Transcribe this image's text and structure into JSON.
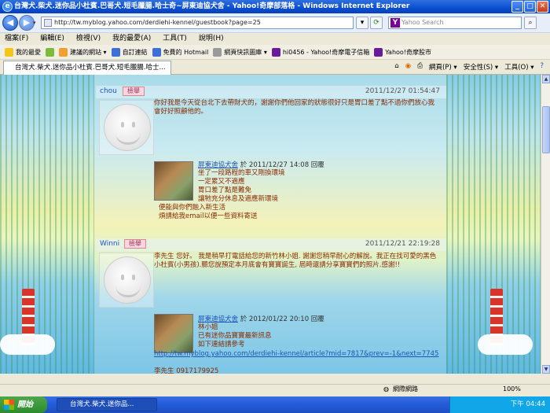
{
  "window": {
    "title": "台灣犬.柴犬.迷你品小杜賓.巴哥犬.短毛臘腸.哈士奇~屏東迪協犬舍 - Yahoo!奇摩部落格 - Windows Internet Explorer"
  },
  "address": {
    "url": "http://tw.myblog.yahoo.com/derdiehi-kennel/guestbook?page=25",
    "search_placeholder": "Yahoo Search"
  },
  "menu": [
    "檔案(F)",
    "編輯(E)",
    "檢視(V)",
    "我的最愛(A)",
    "工具(T)",
    "說明(H)"
  ],
  "favorites": {
    "label": "我的最愛",
    "items": [
      "建議的網站 ▾",
      "自訂連結",
      "免費的 Hotmail",
      "網頁快訊圖庫 ▾",
      "hi0456 - Yahoo!奇摩電子信箱",
      "Yahoo!奇摩股市"
    ]
  },
  "tab": {
    "label": "台灣犬.柴犬.迷你品小杜賓.巴哥犬.短毛臘腸.哈士..."
  },
  "tab_tools": [
    "網頁(P) ▾",
    "安全性(S) ▾",
    "工具(O) ▾"
  ],
  "guestbook": [
    {
      "name": "chou",
      "reply_tag": "檢舉",
      "date": "2011/12/27 01:54:47",
      "message": "你好我是今天從台北下去帶財犬的，謝謝你們他回家的狀態很好只是胃口差了點不過你們放心我會好好照顧他的。",
      "reply": {
        "author": "屏東迪協犬舍",
        "date_text": "於 2011/12/27 14:08 回覆",
        "lines": [
          "坐了一段路程的車又剛換環境",
          "一定累又不適應",
          "胃口差了點是難免",
          "讓牠充分休息及適應新環境",
          "便能與你們融入新生活",
          "煩請給我email以便一些資料寄送"
        ]
      }
    },
    {
      "name": "Winni",
      "reply_tag": "檢舉",
      "date": "2011/12/21 22:19:28",
      "message": "李先生 您好。 我是稍早打電話給您的新竹林小姐. 謝謝您稍早耐心的解說。我正在找可愛的黑色小杜賓(小男孩).聽您說預定本月底會有寶寶誕生, 屆時還請分享寶寶們的照片.感謝!!",
      "reply": {
        "author": "屏東迪協犬舍",
        "date_text": "於 2012/01/22 20:10 回覆",
        "lines": [
          "林小姐",
          "已有迷你品寶寶最新訊息",
          "如下連結請參考"
        ],
        "link": "http://tw.myblog.yahoo.com/derdiehi-kennel/article?mid=7817&prev=-1&next=7745",
        "signature": "李先生 0917179925"
      }
    }
  ],
  "status": {
    "zone": "網際網路",
    "zoom": "100%"
  },
  "taskbar": {
    "start": "開始",
    "item": "台灣犬.柴犬.迷你品...",
    "clock": "下午 04:44"
  }
}
